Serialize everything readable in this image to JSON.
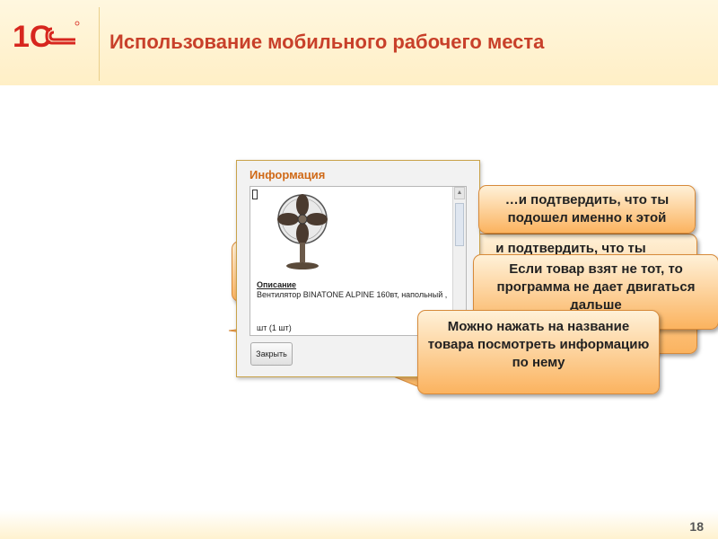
{
  "slide": {
    "title": "Использование мобильного рабочего места",
    "page_number": "18"
  },
  "logo": {
    "text": "1С",
    "color": "#d7261e"
  },
  "dialog": {
    "title": "Информация",
    "description_label": "Описание",
    "description_text": "Вентилятор BINATONE ALPINE 160вт, напольный ,",
    "quantity": "шт (1 шт)",
    "close_label": "Закрыть",
    "image_icon": "fan-icon"
  },
  "callouts": {
    "confirm": "…и подтвердить, что ты подошел именно к этой",
    "hidden_back": "и подтвердить, что ты",
    "wrong_item": "Если товар взят не тот, то программа не дает двигаться дальше",
    "tap_name": "Можно нажать на название товара посмотреть информацию по нему"
  },
  "colors": {
    "title": "#c8402a",
    "callout_fill": "#fbb35f",
    "accent": "#d06a18"
  }
}
